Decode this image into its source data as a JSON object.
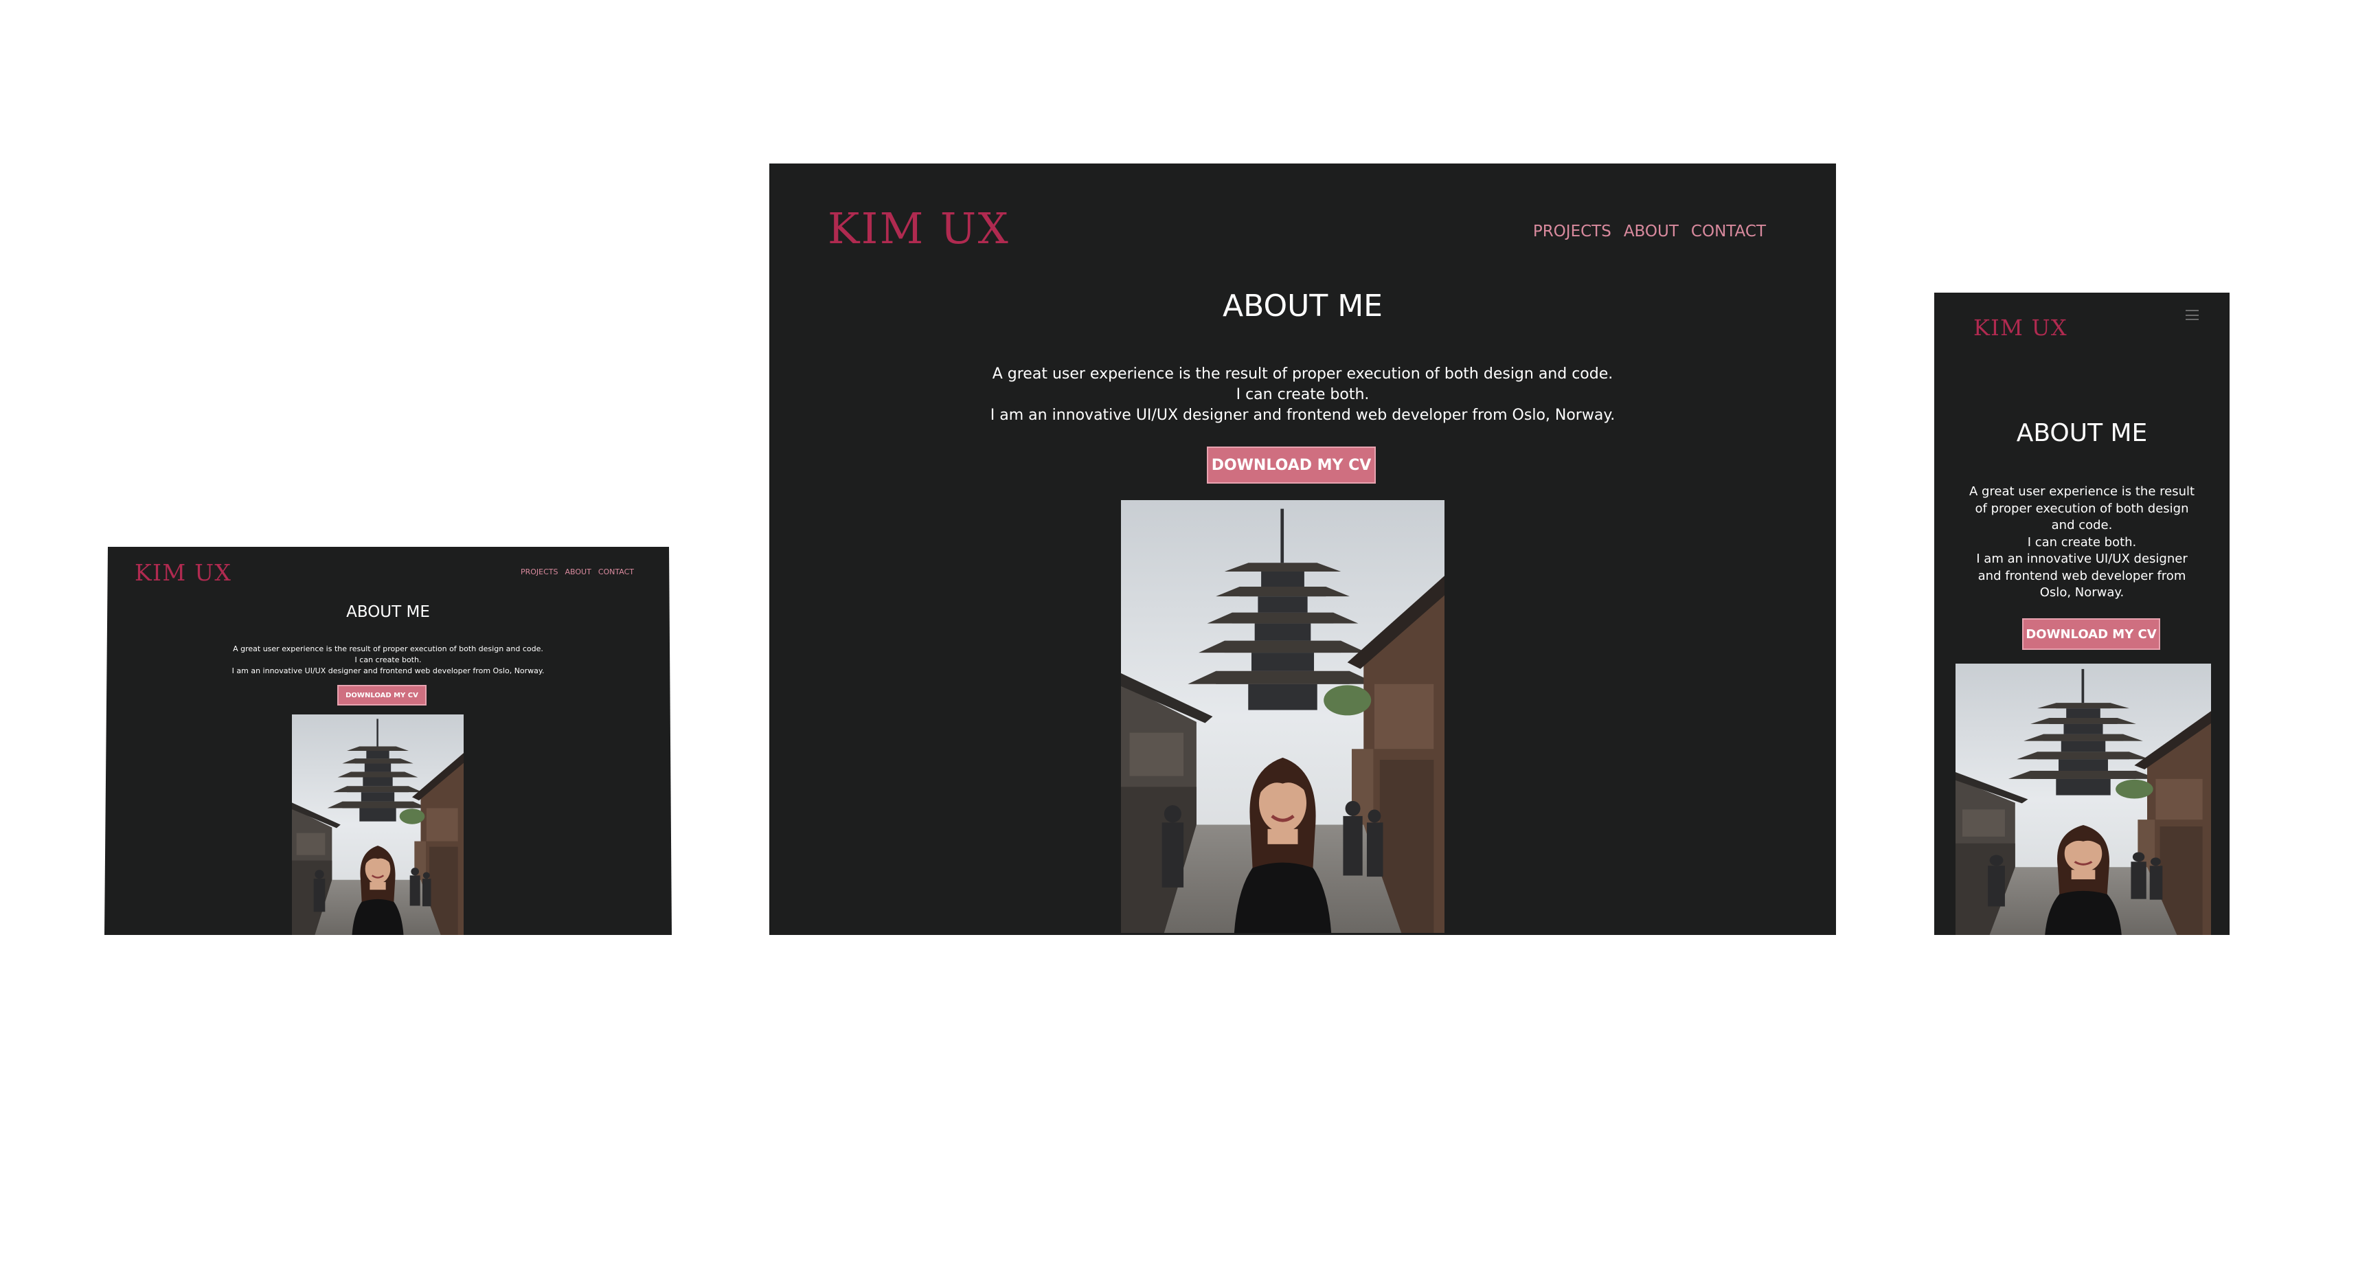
{
  "site": {
    "logo": "KIM UX",
    "nav": [
      "PROJECTS",
      "ABOUT",
      "CONTACT"
    ],
    "heading": "ABOUT ME",
    "intro_lines": [
      "A great user experience is the result of proper execution of both design and code.",
      "I can create both.",
      "I am an innovative UI/UX designer and frontend web developer from Oslo, Norway."
    ],
    "mobile_intro_lines": [
      "A great user experience is the result",
      "of proper execution of both design",
      "and code.",
      "I can create both.",
      "I am an innovative UI/UX designer",
      "and frontend web developer from",
      "Oslo, Norway."
    ],
    "cv_button": "DOWNLOAD MY CV"
  },
  "colors": {
    "page_background": "#ffffff",
    "site_background": "#1d1e1e",
    "logo": "#b02a50",
    "nav_text": "#d98a9e",
    "button_background": "#cf6f80",
    "button_border": "#e8a3b0",
    "text": "#ffffff"
  },
  "icons": {
    "menu": "hamburger-menu-icon"
  },
  "photo": {
    "description_hidden": true
  }
}
